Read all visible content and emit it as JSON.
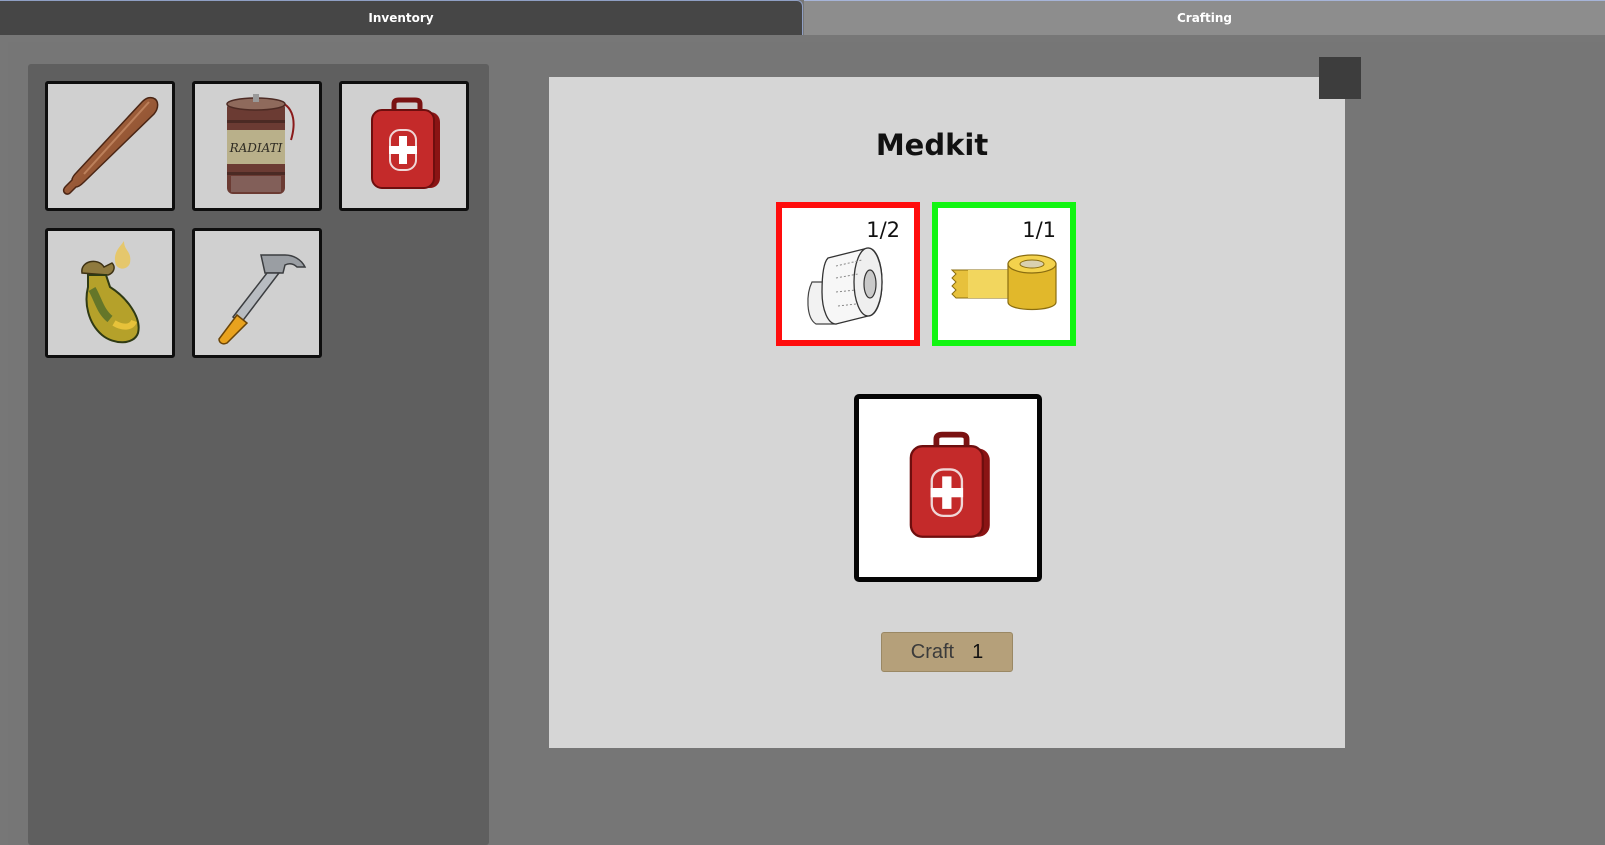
{
  "tabs": {
    "inventory": "Inventory",
    "crafting": "Crafting"
  },
  "inventory": {
    "items": [
      {
        "icon": "baseball-bat-icon"
      },
      {
        "icon": "radiation-barrel-icon"
      },
      {
        "icon": "medkit-icon"
      },
      {
        "icon": "molotov-icon"
      },
      {
        "icon": "hammer-icon"
      }
    ]
  },
  "recipe": {
    "title": "Medkit",
    "ingredients": [
      {
        "icon": "bandage-icon",
        "count": "1/2",
        "status_color": "#ff0d0d"
      },
      {
        "icon": "tape-icon",
        "count": "1/1",
        "status_color": "#12f512"
      }
    ],
    "result_icon": "medkit-icon",
    "craft_label": "Craft",
    "craft_quantity": "1"
  }
}
